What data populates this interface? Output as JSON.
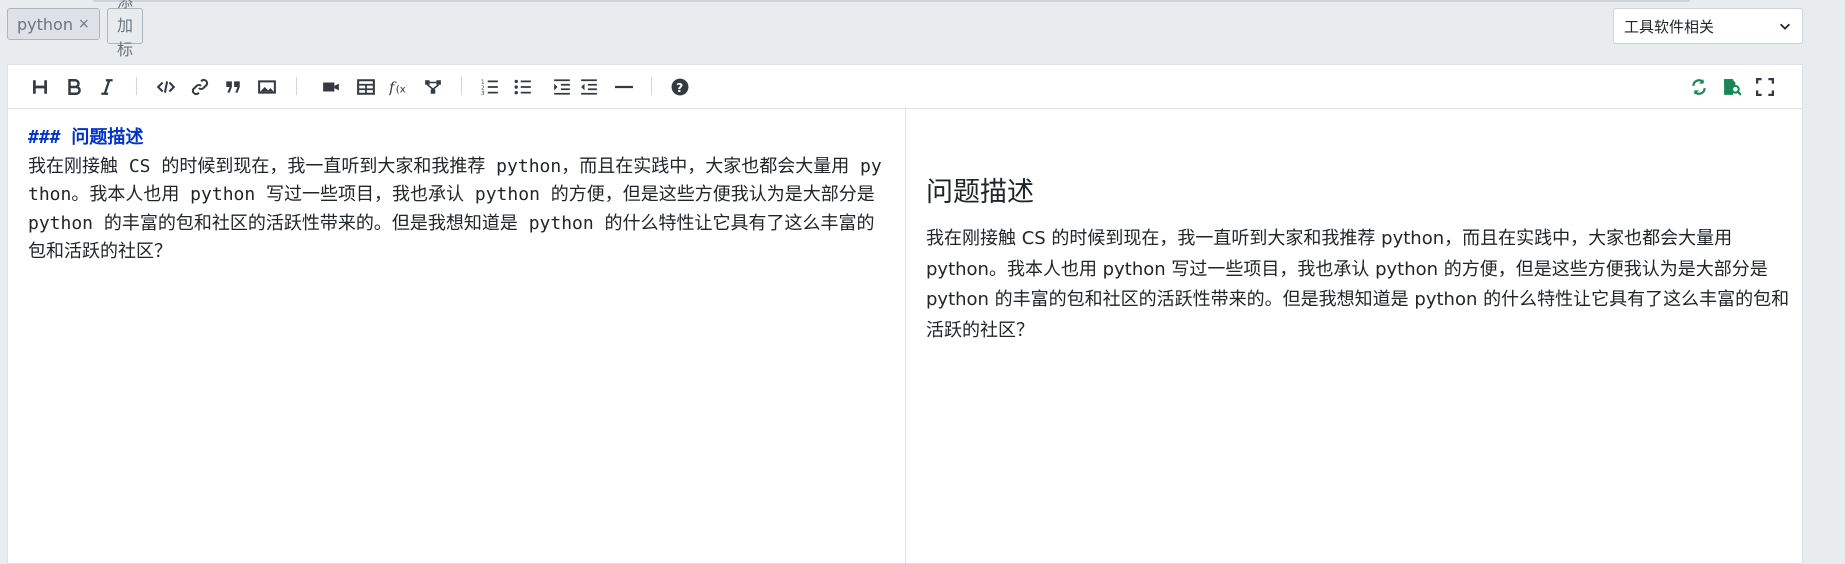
{
  "tags": [
    {
      "label": "python",
      "remove": "×"
    }
  ],
  "add_tag_label": "+ 添加标签",
  "category_select": {
    "value": "工具软件相关",
    "icon": "chevron-down-icon"
  },
  "toolbar": {
    "left_icons": [
      "heading-icon",
      "bold-icon",
      "italic-icon",
      "code-icon",
      "link-icon",
      "quote-icon",
      "image-icon",
      "video-icon",
      "table-icon",
      "formula-icon",
      "diagram-icon",
      "ordered-list-icon",
      "unordered-list-icon",
      "indent-icon",
      "outdent-icon",
      "horizontal-rule-icon",
      "help-icon"
    ],
    "right_icons": [
      "sync-scroll-icon",
      "preview-icon",
      "fullscreen-icon"
    ],
    "accent_color": "#198754"
  },
  "source": {
    "heading": "### 问题描述",
    "body": "我在刚接触 CS 的时候到现在，我一直听到大家和我推荐 python，而且在实践中，大家也都会大量用 python。我本人也用 python 写过一些项目，我也承认 python 的方便，但是这些方便我认为是大部分是 python 的丰富的包和社区的活跃性带来的。但是我想知道是 python 的什么特性让它具有了这么丰富的包和活跃的社区？"
  },
  "preview": {
    "heading": "问题描述",
    "body": "我在刚接触 CS 的时候到现在，我一直听到大家和我推荐 python，而且在实践中，大家也都会大量用 python。我本人也用 python 写过一些项目，我也承认 python 的方便，但是这些方便我认为是大部分是 python 的丰富的包和社区的活跃性带来的。但是我想知道是 python 的什么特性让它具有了这么丰富的包和活跃的社区？"
  }
}
